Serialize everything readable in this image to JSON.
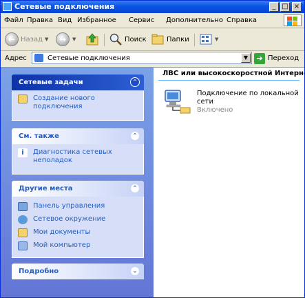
{
  "window": {
    "title": "Сетевые подключения",
    "controls": {
      "minimize": "_",
      "maximize": "□",
      "close": "×"
    }
  },
  "menu": {
    "items": [
      "Файл",
      "Правка",
      "Вид",
      "Избранное",
      "Сервис",
      "Дополнительно",
      "Справка"
    ]
  },
  "toolbar": {
    "back_label": "Назад",
    "search_label": "Поиск",
    "folders_label": "Папки",
    "icons": [
      "back-arrow-icon",
      "forward-arrow-icon",
      "up-folder-icon",
      "search-icon",
      "folders-icon",
      "views-icon"
    ]
  },
  "address": {
    "label": "Адрес",
    "value": "Сетевые подключения",
    "go_label": "Переход"
  },
  "taskpane": {
    "sections": [
      {
        "title": "Сетевые задачи",
        "items": [
          "Создание нового подключения"
        ]
      },
      {
        "title": "См. также",
        "items": [
          "Диагностика сетевых неполадок"
        ]
      },
      {
        "title": "Другие места",
        "items": [
          "Панель управления",
          "Сетевое окружение",
          "Мои документы",
          "Мой компьютер"
        ]
      },
      {
        "title": "Подробно",
        "items": []
      }
    ]
  },
  "rightpane": {
    "group_title": "ЛВС или высокоскоростной Интернет",
    "connection": {
      "name": "Подключение по локальной сети",
      "status": "Включено"
    }
  },
  "colors": {
    "titlebar": "#0a53e4",
    "taskpane_bg": "#7ba2e7",
    "link": "#215dc6"
  }
}
